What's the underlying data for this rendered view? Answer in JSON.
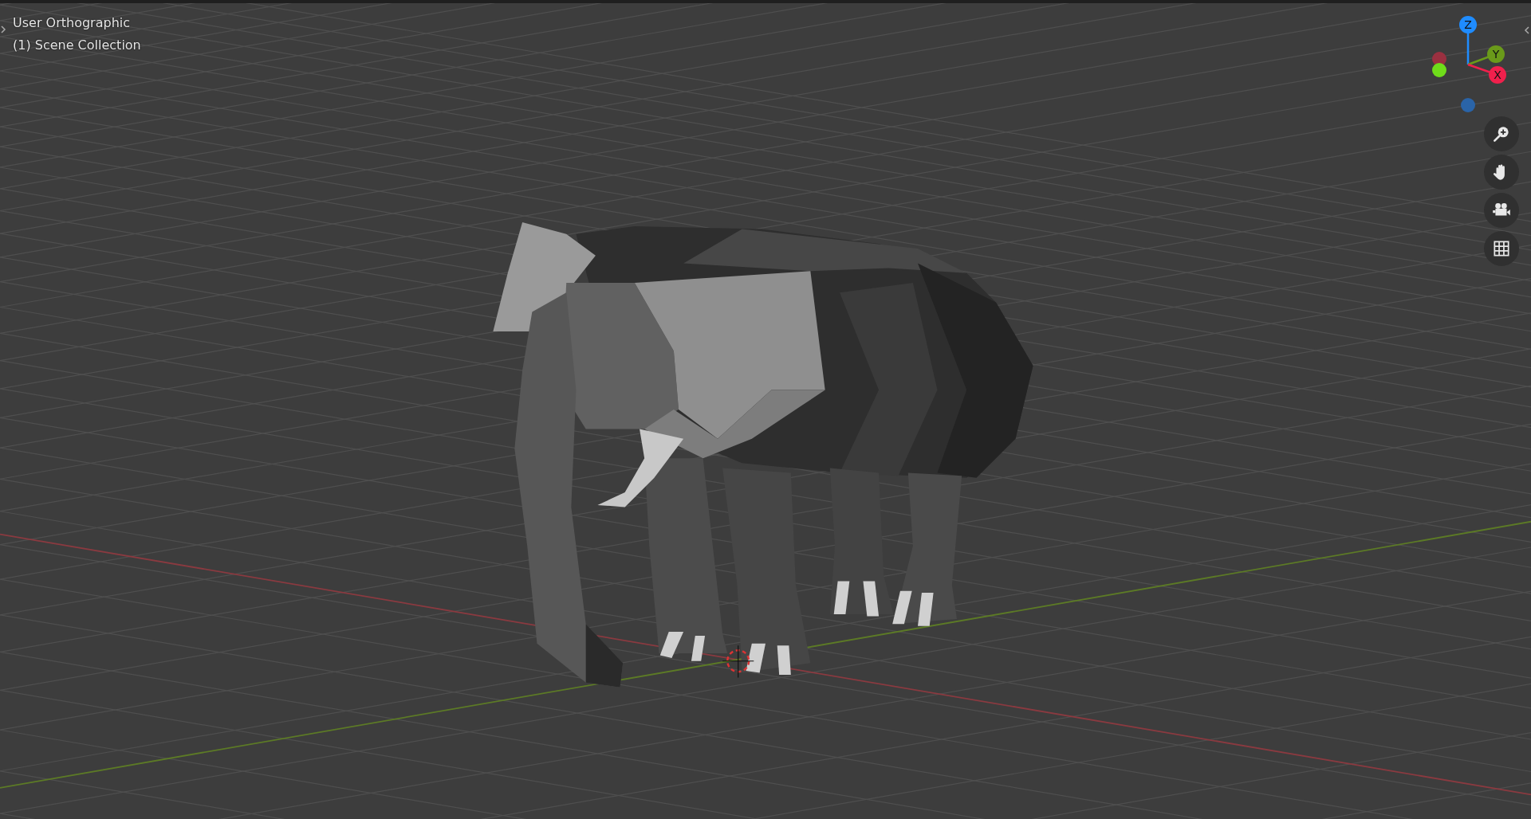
{
  "viewport": {
    "header_lines": [
      "User Orthographic",
      "(1) Scene Collection"
    ]
  },
  "gizmo": {
    "axes": [
      {
        "label": "Z"
      },
      {
        "label": "Y"
      },
      {
        "label": "X"
      }
    ]
  },
  "nav_buttons": [
    {
      "kind": "zoom"
    },
    {
      "kind": "pan"
    },
    {
      "kind": "camera"
    },
    {
      "kind": "grid"
    }
  ]
}
